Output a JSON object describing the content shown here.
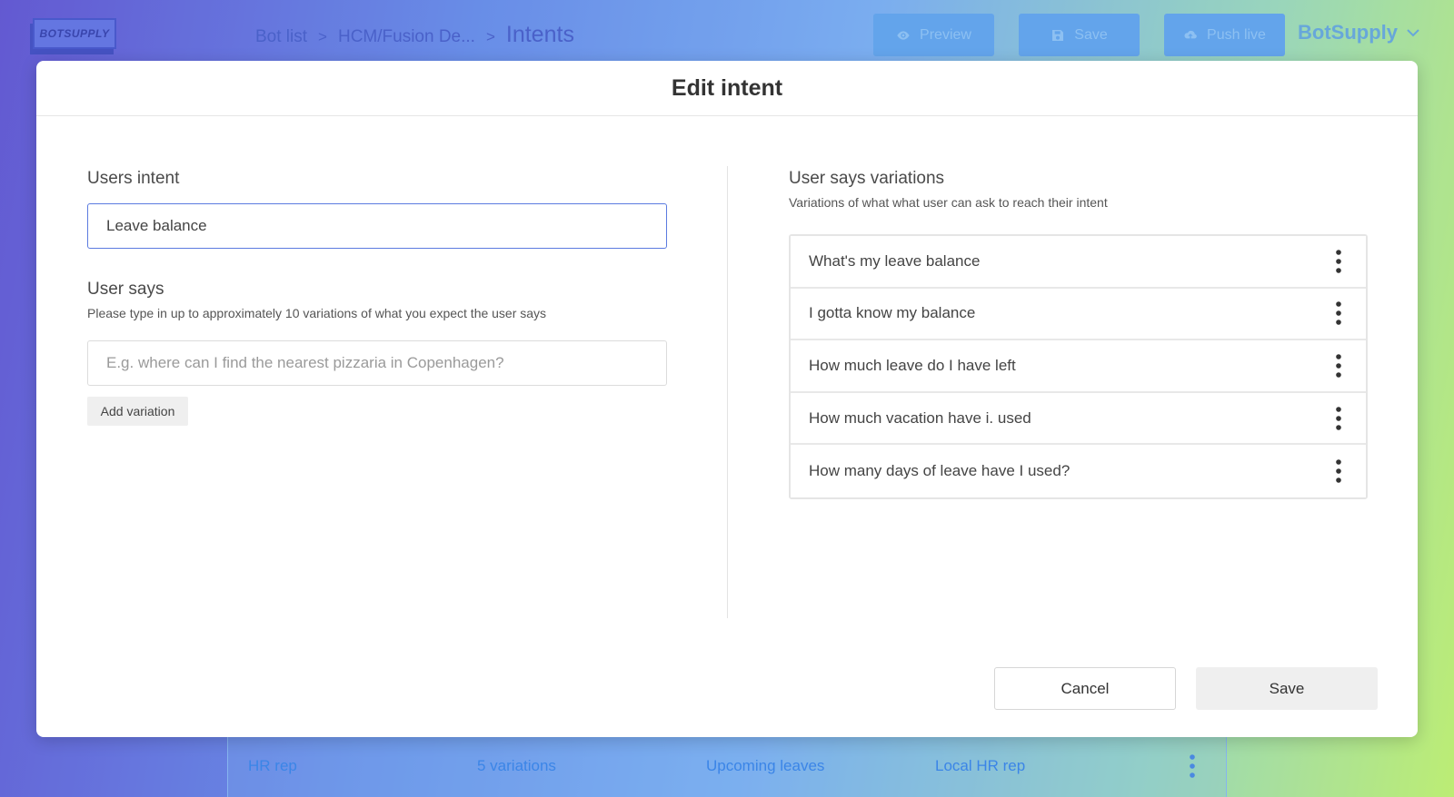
{
  "header": {
    "logo_text": "BOTSUPPLY",
    "breadcrumb": [
      "Bot list",
      "HCM/Fusion De...",
      "Intents"
    ],
    "breadcrumb_sep": ">",
    "buttons": {
      "preview": "Preview",
      "save": "Save",
      "push_live": "Push live"
    },
    "account_name": "BotSupply"
  },
  "background_row": {
    "cells": [
      "HR rep",
      "5 variations",
      "Upcoming leaves",
      "Local HR rep"
    ]
  },
  "modal": {
    "title": "Edit intent",
    "users_intent": {
      "label": "Users intent",
      "value": "Leave balance"
    },
    "user_says": {
      "label": "User says",
      "hint": "Please type in up to approximately 10 variations of what you expect the user says",
      "placeholder": "E.g. where can I find the nearest pizzaria in Copenhagen?",
      "add_label": "Add variation"
    },
    "variations": {
      "label": "User says variations",
      "hint": "Variations of what what user can ask to reach their intent",
      "items": [
        "What's my leave balance",
        "I gotta know my balance",
        "How much leave do I have left",
        "How much vacation have i. used",
        "How many days of leave have I used?"
      ]
    },
    "cancel_label": "Cancel",
    "save_label": "Save"
  },
  "colors": {
    "accent": "#5b7be0",
    "header_button": "#5a9fea",
    "link_blue": "#2f7ee6"
  },
  "icons": [
    "eye-icon",
    "floppy-disk-icon",
    "cloud-upload-icon",
    "chevron-down-icon",
    "kebab-menu-icon"
  ]
}
